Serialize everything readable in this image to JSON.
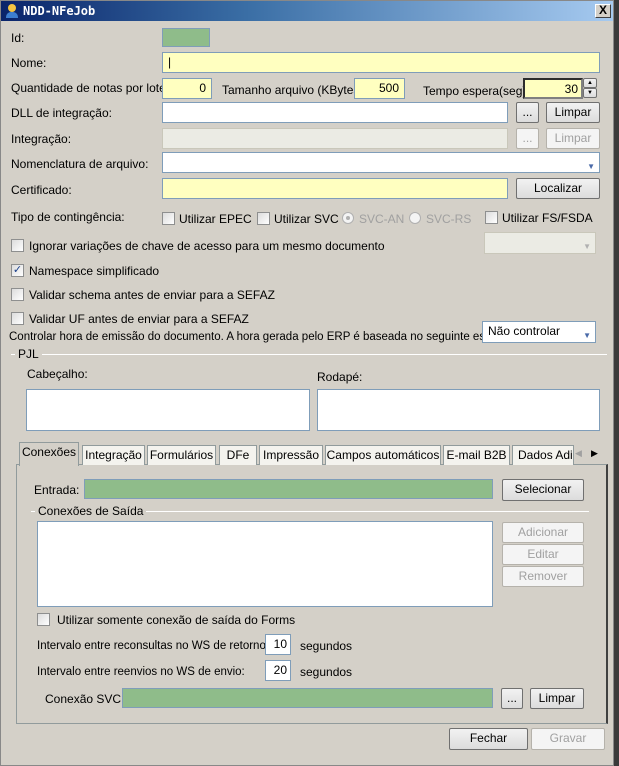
{
  "window": {
    "title": "NDD-NFeJob",
    "close": "X"
  },
  "form": {
    "id_label": "Id:",
    "nome_label": "Nome:",
    "nome_value": "|",
    "qtd_label": "Quantidade de notas por lote:",
    "qtd_value": "0",
    "tamanho_label": "Tamanho arquivo (KBytes):",
    "tamanho_value": "500",
    "tempo_label": "Tempo espera(seg):",
    "tempo_value": "30",
    "dll_label": "DLL de integração:",
    "integracao_label": "Integração:",
    "nomenclatura_label": "Nomenclatura de arquivo:",
    "certificado_label": "Certificado:",
    "browse": "...",
    "limpar": "Limpar",
    "localizar": "Localizar",
    "contingencia_label": "Tipo de contingência:",
    "epec": "Utilizar EPEC",
    "svc": "Utilizar SVC",
    "svc_an": "SVC-AN",
    "svc_rs": "SVC-RS",
    "fsda": "Utilizar FS/FSDA",
    "ignorar": "Ignorar variações de chave de acesso para um mesmo documento",
    "namespace": "Namespace simplificado",
    "namespace_checked": true,
    "validar_schema": "Validar schema antes de enviar para a SEFAZ",
    "validar_uf": "Validar UF antes de enviar para a SEFAZ",
    "controlar_label": "Controlar hora de emissão do documento. A hora gerada pelo ERP é baseada no seguinte estado:",
    "controlar_value": "Não controlar",
    "pjl_label": "PJL",
    "cabecalho": "Cabeçalho:",
    "rodape": "Rodapé:"
  },
  "tabs": [
    "Conexões",
    "Integração",
    "Formulários",
    "DFe",
    "Impressão",
    "Campos automáticos",
    "E-mail B2B",
    "Dados Adic"
  ],
  "conexoes": {
    "entrada_label": "Entrada:",
    "selecionar": "Selecionar",
    "saida_group": "Conexões de Saída",
    "adicionar": "Adicionar",
    "editar": "Editar",
    "remover": "Remover",
    "somente_forms": "Utilizar somente conexão de saída do Forms",
    "reconsultas_label": "Intervalo entre reconsultas no WS de retorno:",
    "reconsultas_value": "10",
    "reenvios_label": "Intervalo entre reenvios no WS de envio:",
    "reenvios_value": "20",
    "segundos": "segundos",
    "svc_label": "Conexão SVC:",
    "browse": "...",
    "limpar": "Limpar"
  },
  "footer": {
    "fechar": "Fechar",
    "gravar": "Gravar"
  }
}
